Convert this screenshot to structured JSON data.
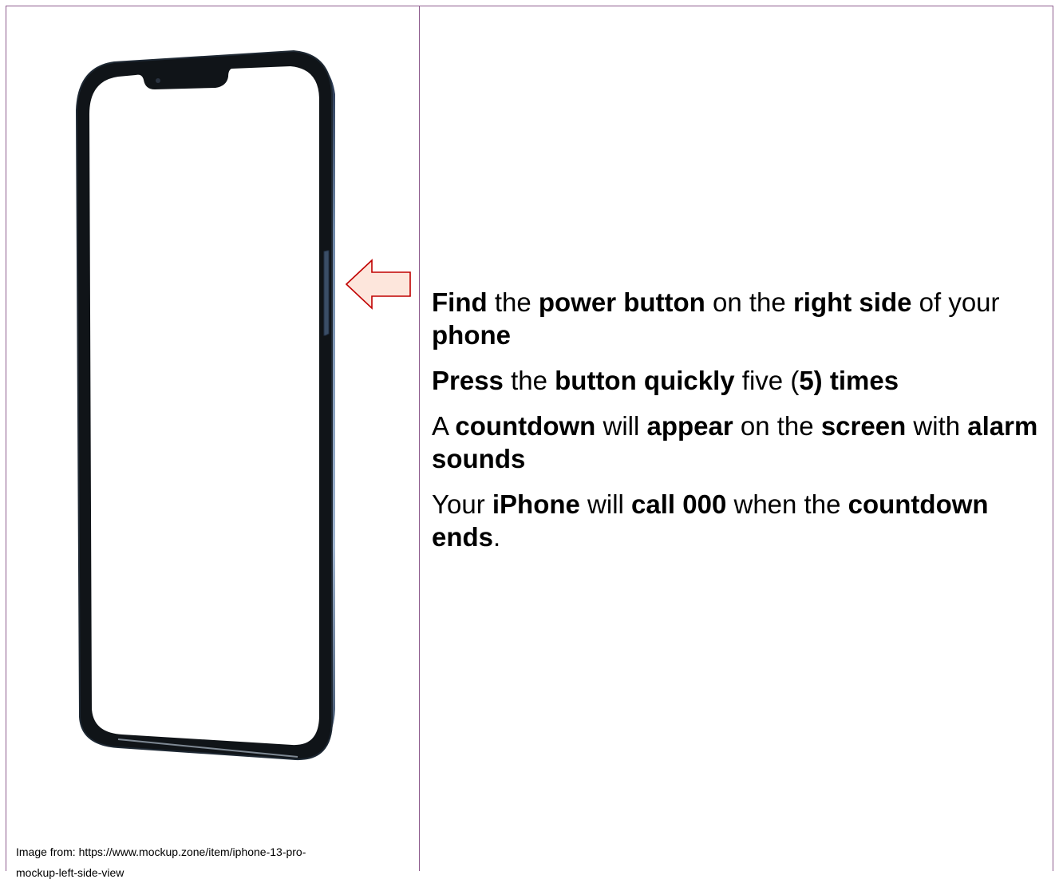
{
  "caption": {
    "line1": "Image from: https://www.mockup.zone/item/iphone-13-pro-",
    "line2": "mockup-left-side-view"
  },
  "steps": [
    {
      "id": "find",
      "parts": [
        {
          "t": "Find",
          "b": true
        },
        {
          "t": " the ",
          "b": false
        },
        {
          "t": "power button",
          "b": true
        },
        {
          "t": " on the ",
          "b": false
        },
        {
          "t": "right side",
          "b": true
        },
        {
          "t": " of your ",
          "b": false
        },
        {
          "t": "phone",
          "b": true
        }
      ]
    },
    {
      "id": "press",
      "parts": [
        {
          "t": "Press",
          "b": true
        },
        {
          "t": " the ",
          "b": false
        },
        {
          "t": "button quickly",
          "b": true
        },
        {
          "t": " five (",
          "b": false
        },
        {
          "t": "5) times",
          "b": true
        }
      ]
    },
    {
      "id": "countdown",
      "parts": [
        {
          "t": "A ",
          "b": false
        },
        {
          "t": "countdown",
          "b": true
        },
        {
          "t": " will ",
          "b": false
        },
        {
          "t": "appear",
          "b": true
        },
        {
          "t": " on the ",
          "b": false
        },
        {
          "t": "screen",
          "b": true
        },
        {
          "t": " with ",
          "b": false
        },
        {
          "t": "alarm sounds",
          "b": true
        }
      ]
    },
    {
      "id": "call",
      "parts": [
        {
          "t": "Your ",
          "b": false
        },
        {
          "t": "iPhone",
          "b": true
        },
        {
          "t": " will ",
          "b": false
        },
        {
          "t": "call 000",
          "b": true
        },
        {
          "t": " when the ",
          "b": false
        },
        {
          "t": "countdown ends",
          "b": true
        },
        {
          "t": ".",
          "b": false
        }
      ]
    }
  ],
  "colors": {
    "border": "#8c5a8c",
    "arrow_fill": "#fde6dc",
    "arrow_stroke": "#c00000",
    "phone_frame": "#2c3a4e",
    "phone_side": "#8ea6c3"
  }
}
